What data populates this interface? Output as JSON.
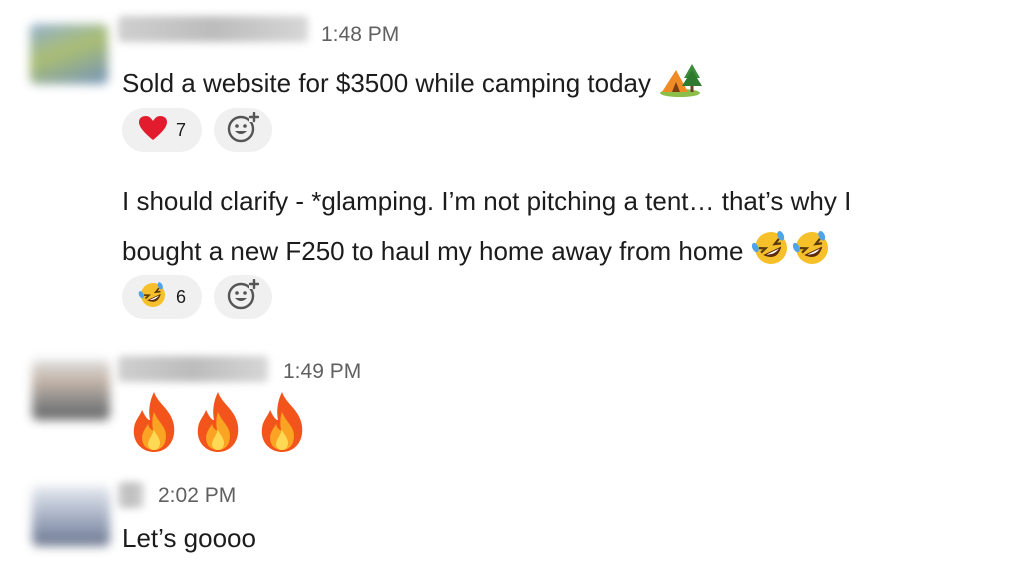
{
  "messages": [
    {
      "time": "1:48 PM",
      "text": "Sold a website for $3500 while camping today",
      "reaction": {
        "emoji": "heart-icon",
        "count": "7"
      }
    },
    {
      "line1": "I should clarify - *glamping. I’m not pitching a tent… that’s why I",
      "line2": "bought a new F250 to haul my home away from home",
      "reaction": {
        "emoji": "rofl-icon",
        "count": "6"
      }
    },
    {
      "time": "1:49 PM",
      "emojis": [
        "fire-icon",
        "fire-icon",
        "fire-icon"
      ]
    },
    {
      "time": "2:02 PM",
      "text": "Let’s goooo"
    }
  ]
}
